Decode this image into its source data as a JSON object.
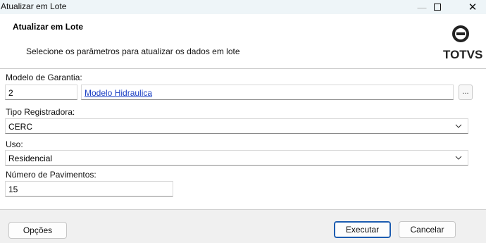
{
  "window": {
    "title": "Atualizar em Lote"
  },
  "header": {
    "title": "Atualizar em Lote",
    "description": "Selecione os parâmetros para atualizar os dados em lote",
    "logo_text": "TOTVS"
  },
  "form": {
    "modelo_garantia": {
      "label": "Modelo de Garantia:",
      "code": "2",
      "description": "Modelo Hidraulica",
      "browse_label": "..."
    },
    "tipo_registradora": {
      "label": "Tipo Registradora:",
      "value": "CERC"
    },
    "uso": {
      "label": "Uso:",
      "value": "Residencial"
    },
    "numero_pavimentos": {
      "label": "Número de Pavimentos:",
      "value": "15"
    }
  },
  "footer": {
    "options_label": "Opções",
    "execute_label": "Executar",
    "cancel_label": "Cancelar"
  },
  "colors": {
    "titlebar_bg": "#eef5f8",
    "link": "#1a3fc4",
    "primary_border": "#1c5cb0",
    "footer_bg": "#f0f0f0"
  },
  "icons": {
    "logo": "totvs-logo-icon",
    "minimize": "minimize-icon",
    "maximize": "maximize-icon",
    "close": "close-icon",
    "dropdown": "chevron-down-icon"
  }
}
